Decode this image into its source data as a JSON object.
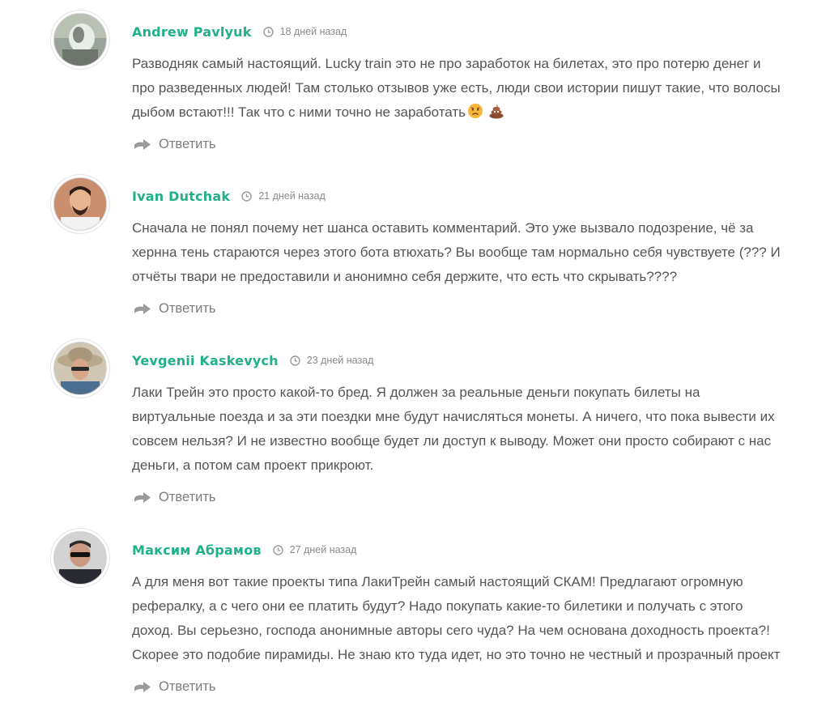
{
  "comments": [
    {
      "author": "Andrew Pavlyuk",
      "date": "18 дней назад",
      "lines": [
        "Разводняк самый настоящий. Lucky train это не про заработок на билетах, это про потерю денег и",
        "про разведенных людей! Там столько отзывов уже есть, люди свои истории пишут такие, что волосы",
        "дыбом встают!!! Так что с ними точно не заработать"
      ],
      "emojis": [
        "sad-face-emoji",
        "poop-emoji"
      ],
      "reply_label": "Ответить"
    },
    {
      "author": "Ivan Dutchak",
      "date": "21 дней назад",
      "lines": [
        "Сначала не понял почему нет шанса оставить комментарий. Это уже вызвало подозрение, чё за",
        "хернна тень стараются через этого бота втюхать? Вы вообще там нормально себя чувствуете (??? И",
        "отчёты твари не предоставили и анонимно себя держите, что есть что скрывать????"
      ],
      "reply_label": "Ответить"
    },
    {
      "author": "Yevgenii Kaskevych",
      "date": "23 дней назад",
      "lines": [
        "Лаки Трейн это просто какой-то бред. Я должен за реальные деньги покупать билеты на",
        "виртуальные поезда и за эти поездки мне будут начисляться монеты. А ничего, что пока вывести их",
        "совсем нельзя? И не известно вообще будет ли доступ к выводу. Может они просто собирают с нас",
        "деньги, а потом сам проект прикроют."
      ],
      "reply_label": "Ответить"
    },
    {
      "author": "Максим Абрамов",
      "date": "27 дней назад",
      "lines": [
        "А для меня вот такие проекты типа ЛакиТрейн самый настоящий СКАМ! Предлагают огромную",
        "рефералку, а с чего они ее платить будут? Надо покупать какие-то билетики и получать с этого",
        "доход. Вы серьезно, господа анонимные авторы сего чуда? На чем основана доходность проекта?!",
        "Скорее это подобие пирамиды. Не знаю кто туда идет, но это точно не честный и прозрачный проект"
      ],
      "reply_label": "Ответить"
    }
  ],
  "colors": {
    "author": "#20b08a",
    "text": "#555555",
    "meta": "#8a8a8a",
    "reply": "#7d7d7d"
  },
  "icons": {
    "date": "clock-icon",
    "reply": "reply-arrow-icon"
  }
}
